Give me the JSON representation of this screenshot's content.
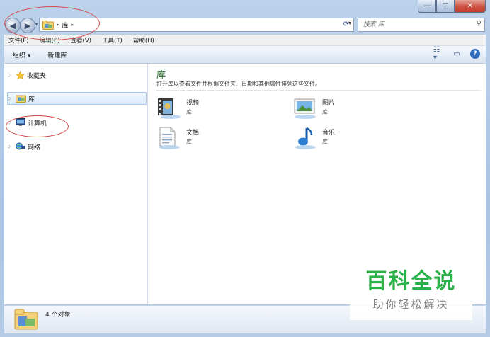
{
  "window": {
    "minimize_glyph": "—",
    "maximize_glyph": "□",
    "close_glyph": "✕"
  },
  "address": {
    "crumb": "库",
    "search_placeholder": "搜索 库"
  },
  "menu": [
    "文件(F)",
    "编辑(E)",
    "查看(V)",
    "工具(T)",
    "帮助(H)"
  ],
  "toolbar": {
    "organize": "组织 ▾",
    "new_library": "新建库"
  },
  "nav": {
    "favorites": "收藏夹",
    "libraries": "库",
    "computer": "计算机",
    "network": "网络"
  },
  "content": {
    "title": "库",
    "description": "打开库以查看文件并根据文件夹、日期和其他属性排列这些文件。",
    "libraries": [
      {
        "name": "视频",
        "type": "库",
        "icon": "video-library-icon"
      },
      {
        "name": "图片",
        "type": "库",
        "icon": "pictures-library-icon"
      },
      {
        "name": "文档",
        "type": "库",
        "icon": "documents-library-icon"
      },
      {
        "name": "音乐",
        "type": "库",
        "icon": "music-library-icon"
      }
    ]
  },
  "status": {
    "count": "4 个对象"
  },
  "watermark": {
    "main": "百科全说",
    "sub": "助你轻松解决"
  },
  "colors": {
    "title_green": "#1e6b25",
    "watermark_green": "#2bb14a",
    "annotation_red": "#d44a4a"
  }
}
